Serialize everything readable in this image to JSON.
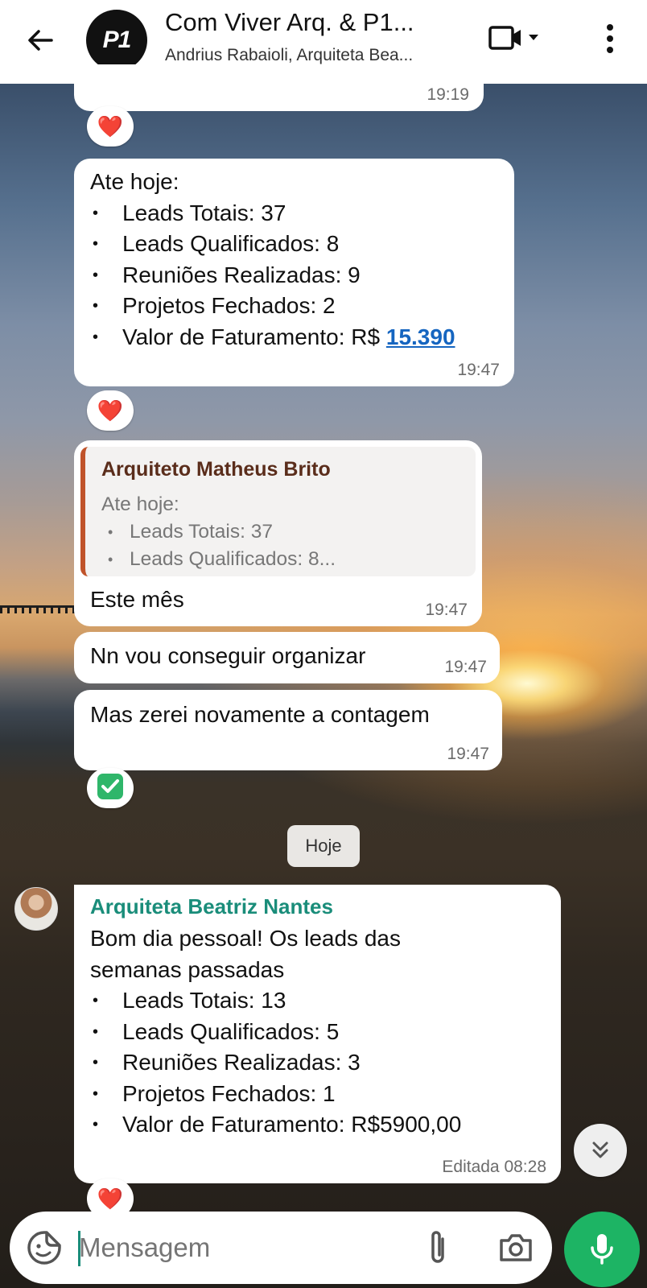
{
  "header": {
    "title": "Com Viver Arq. & P1...",
    "subtitle": "Andrius Rabaioli, Arquiteta Bea...",
    "avatar_text": "P1"
  },
  "messages": [
    {
      "time": "19:19",
      "reaction": "❤️"
    },
    {
      "intro": "Ate hoje:",
      "items": [
        "Leads Totais: 37",
        "Leads Qualificados: 8",
        "Reuniões Realizadas: 9",
        "Projetos Fechados: 2"
      ],
      "last_item_prefix": "Valor de Faturamento: R$ ",
      "last_item_link": "15.390",
      "time": "19:47",
      "reaction": "❤️"
    },
    {
      "quote_author": "Arquiteto Matheus Brito",
      "quote_intro": "Ate hoje:",
      "quote_items": [
        "Leads Totais: 37",
        "Leads Qualificados: 8..."
      ],
      "text": "Este mês",
      "time": "19:47"
    },
    {
      "text": "Nn vou conseguir organizar",
      "time": "19:47"
    },
    {
      "text": "Mas zerei novamente a contagem",
      "time": "19:47",
      "reaction": "✅"
    }
  ],
  "day_separator": "Hoje",
  "incoming": {
    "sender": "Arquiteta Beatriz Nantes",
    "line1": "Bom dia pessoal! Os leads das",
    "line2": "semanas passadas",
    "items": [
      "Leads Totais: 13",
      "Leads Qualificados: 5",
      "Reuniões Realizadas: 3",
      "Projetos Fechados: 1",
      "Valor de Faturamento: R$5900,00"
    ],
    "time": "Editada 08:28",
    "reaction": "❤️"
  },
  "input": {
    "placeholder": "Mensagem"
  },
  "colors": {
    "accent": "#1db464",
    "sender_name": "#1a8d7a",
    "link": "#1565c0",
    "quote_bar": "#c0532a"
  }
}
